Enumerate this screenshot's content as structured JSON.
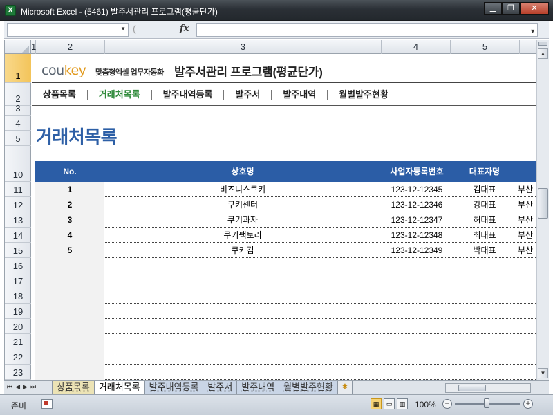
{
  "window": {
    "title": "Microsoft Excel - (5461) 발주서관리 프로그램(평균단가)",
    "icon": "excel-icon"
  },
  "formula_bar": {
    "name_box": "",
    "fx_label": "fx",
    "formula": ""
  },
  "columns": [
    "1",
    "2",
    "3",
    "4",
    "5"
  ],
  "rows": [
    "1",
    "2",
    "3",
    "4",
    "5",
    "10",
    "11",
    "12",
    "13",
    "14",
    "15",
    "16",
    "17",
    "18",
    "19",
    "20",
    "21",
    "22",
    "23"
  ],
  "brand": {
    "logo_cou": "cou",
    "logo_key": "key",
    "tagline": "맞춤형엑셀 업무자동화",
    "app_title": "발주서관리 프로그램(평균단가)"
  },
  "nav": {
    "items": [
      "상품목록",
      "거래처목록",
      "발주내역등록",
      "발주서",
      "발주내역",
      "월별발주현황"
    ],
    "active": "거래처목록"
  },
  "page_heading": "거래처목록",
  "table": {
    "headers": [
      "No.",
      "상호명",
      "사업자등록번호",
      "대표자명"
    ],
    "rows": [
      {
        "no": "1",
        "name": "비즈니스쿠키",
        "biz": "123-12-12345",
        "rep": "김대표",
        "addr": "부산"
      },
      {
        "no": "2",
        "name": "쿠키센터",
        "biz": "123-12-12346",
        "rep": "강대표",
        "addr": "부산"
      },
      {
        "no": "3",
        "name": "쿠키과자",
        "biz": "123-12-12347",
        "rep": "허대표",
        "addr": "부산"
      },
      {
        "no": "4",
        "name": "쿠키팩토리",
        "biz": "123-12-12348",
        "rep": "최대표",
        "addr": "부산"
      },
      {
        "no": "5",
        "name": "쿠키김",
        "biz": "123-12-12349",
        "rep": "박대표",
        "addr": "부산"
      }
    ]
  },
  "sheet_tabs": [
    "상품목록",
    "거래처목록",
    "발주내역등록",
    "발주서",
    "발주내역",
    "월별발주현황"
  ],
  "active_tab": "거래처목록",
  "status": {
    "text": "준비",
    "zoom": "100%"
  }
}
